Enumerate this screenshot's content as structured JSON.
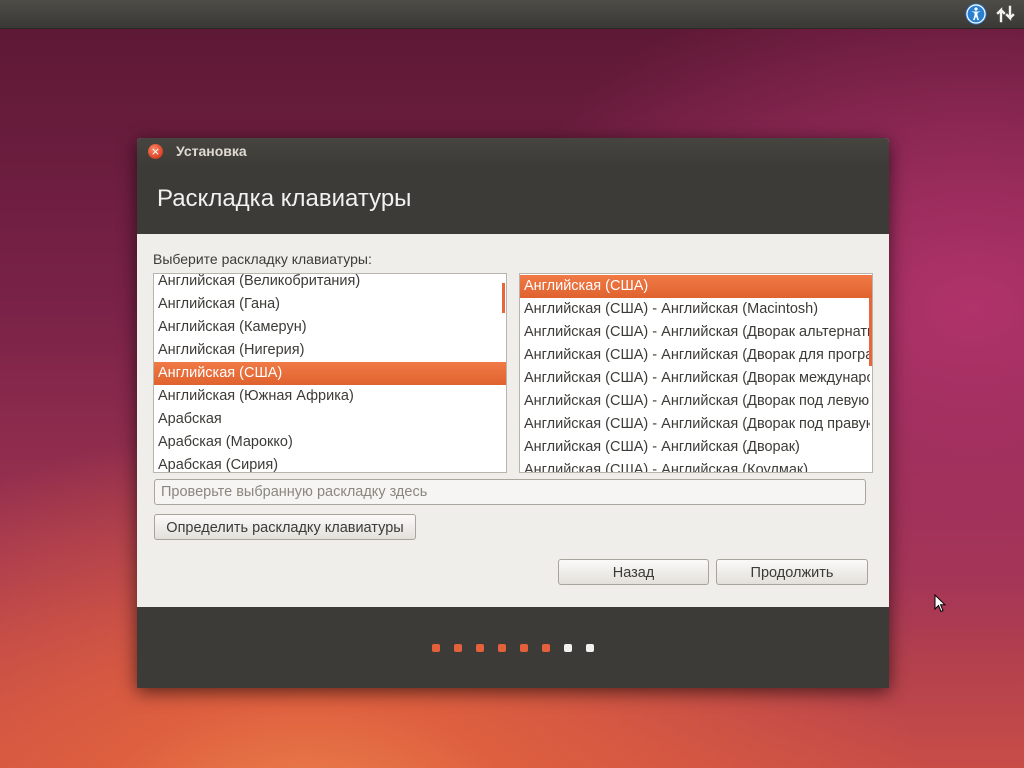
{
  "window": {
    "title": "Установка",
    "heading": "Раскладка клавиатуры",
    "close_icon": "×"
  },
  "prompt_label": "Выберите раскладку клавиатуры:",
  "layouts_list": {
    "items": [
      "Английская (Великобритания)",
      "Английская (Гана)",
      "Английская (Камерун)",
      "Английская (Нигерия)",
      "Английская (США)",
      "Английская (Южная Африка)",
      "Арабская",
      "Арабская (Марокко)",
      "Арабская (Сирия)"
    ],
    "selected": "Английская (США)"
  },
  "variants_list": {
    "items": [
      "Английская (США)",
      "Английская (США) - Английская (Macintosh)",
      "Английская (США) - Английская (Дворак альтернативная международная)",
      "Английская (США) - Английская (Дворак для программистов)",
      "Английская (США) - Английская (Дворак международная)",
      "Английская (США) - Английская (Дворак под левую руку)",
      "Английская (США) - Английская (Дворак под правую руку)",
      "Английская (США) - Английская (Дворак)",
      "Английская (США) - Английская (Коулмак)"
    ],
    "selected": "Английская (США)"
  },
  "test_input": {
    "placeholder": "Проверьте выбранную раскладку здесь",
    "value": ""
  },
  "buttons": {
    "detect": "Определить раскладку клавиатуры",
    "back": "Назад",
    "continue": "Продолжить"
  },
  "progress": {
    "total_steps": 8,
    "completed_steps": 6
  },
  "top_panel": {
    "icons": [
      "accessibility-icon",
      "network-icon"
    ]
  },
  "colors": {
    "accent": "#e2613a",
    "selection": "#f07a46",
    "window_dark": "#3c3b37",
    "window_bg": "#f0eeea"
  }
}
